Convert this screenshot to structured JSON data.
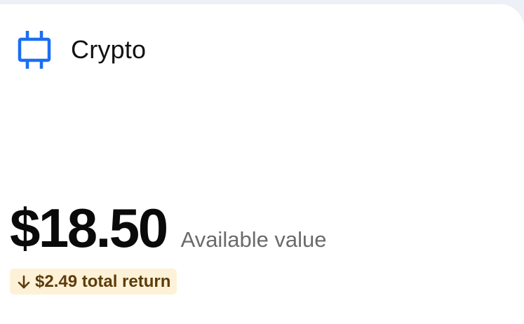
{
  "card": {
    "icon": "crypto-chip-icon",
    "title": "Crypto"
  },
  "balance": {
    "amount": "$18.50",
    "label": "Available value"
  },
  "return": {
    "direction_icon": "arrow-down-icon",
    "text": "$2.49 total return"
  },
  "colors": {
    "accent_blue": "#1a6ff2",
    "return_badge_bg": "#fdf1d8",
    "return_text": "#5e3c0a"
  }
}
